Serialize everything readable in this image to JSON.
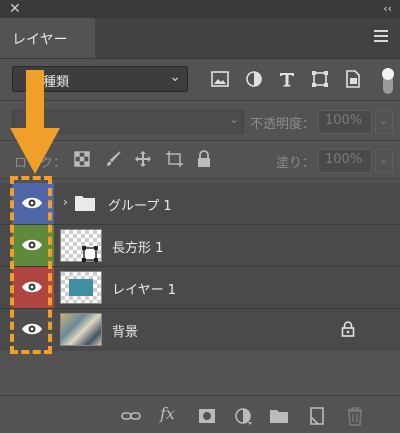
{
  "window": {
    "close_glyph": "✕",
    "collapse_glyph": "‹‹"
  },
  "panel": {
    "tab_label": "レイヤー",
    "menu_icon": "hamburger-icon"
  },
  "filter": {
    "kind_label": "種類",
    "icons": [
      "image-filter-icon",
      "adjustment-filter-icon",
      "type-filter-icon",
      "shape-filter-icon",
      "smart-object-filter-icon"
    ]
  },
  "blend": {
    "opacity_label": "不透明度：",
    "opacity_value": "100%"
  },
  "lock": {
    "label": "ロック：",
    "fill_label": "塗り：",
    "fill_value": "100%",
    "icons": [
      "lock-transparent-pixels-icon",
      "lock-image-pixels-icon",
      "lock-position-icon",
      "lock-artboard-icon",
      "lock-all-icon"
    ]
  },
  "layers": [
    {
      "name": "グループ 1",
      "eye_color": "#4f67a8",
      "type": "group"
    },
    {
      "name": "長方形 1",
      "eye_color": "#5f8a3c",
      "type": "shape"
    },
    {
      "name": "レイヤー 1",
      "eye_color": "#b04440",
      "type": "pixel"
    },
    {
      "name": "背景",
      "eye_color": "#4e4e4e",
      "type": "background",
      "locked": true
    }
  ],
  "annotation": {
    "arrow_color": "#f0a028",
    "box_color": "#f0a028"
  },
  "bottom_bar": {
    "fx_label": "fx",
    "icons": [
      "link-layers-icon",
      "fx-icon",
      "add-mask-icon",
      "new-fill-adjustment-icon",
      "new-group-icon",
      "new-layer-icon",
      "delete-icon"
    ]
  }
}
